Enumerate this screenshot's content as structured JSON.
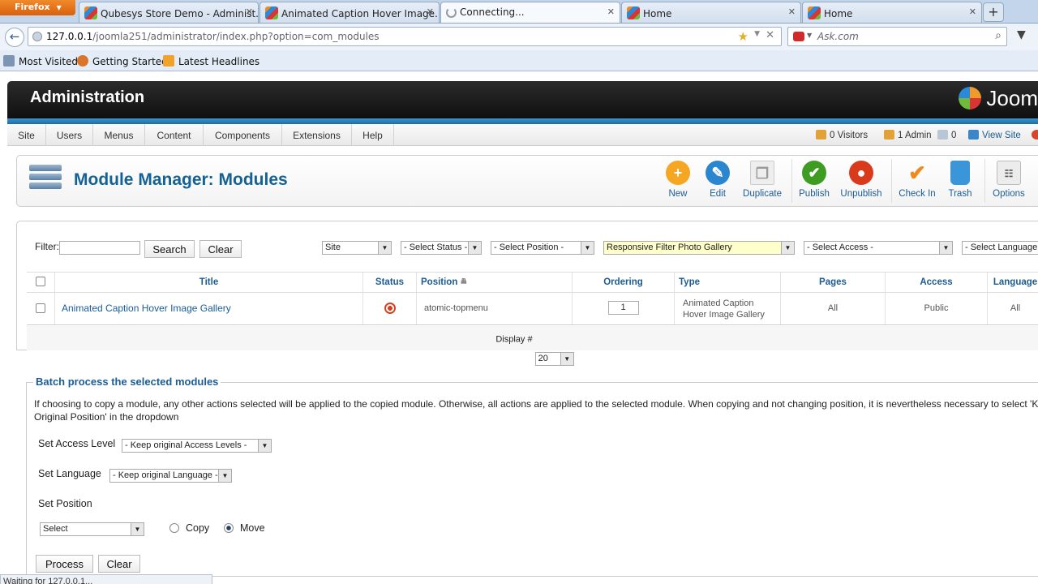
{
  "browser": {
    "menu_label": "Firefox",
    "tabs": [
      {
        "title": "Qubesys Store Demo - Administ..."
      },
      {
        "title": "Animated Caption Hover Image..."
      },
      {
        "title": "Connecting..."
      },
      {
        "title": "Home"
      },
      {
        "title": "Home"
      }
    ],
    "url_host": "127.0.0.1",
    "url_rest": "/joomla251/administrator/index.php?option=com_modules",
    "search_placeholder": "Ask.com",
    "bookmarks": [
      "Most Visited",
      "Getting Started",
      "Latest Headlines"
    ],
    "status_text": "Waiting for 127.0.0.1..."
  },
  "header": {
    "title": "Administration",
    "logo_text": "Joom"
  },
  "menu": {
    "items": [
      "Site",
      "Users",
      "Menus",
      "Content",
      "Components",
      "Extensions",
      "Help"
    ],
    "visitors": "0 Visitors",
    "admins": "1 Admin",
    "messages": "0",
    "view_site": "View Site"
  },
  "toolbar": {
    "page_title": "Module Manager: Modules",
    "buttons": {
      "new": "New",
      "edit": "Edit",
      "duplicate": "Duplicate",
      "publish": "Publish",
      "unpublish": "Unpublish",
      "checkin": "Check In",
      "trash": "Trash",
      "options": "Options"
    },
    "colors": {
      "new": "#f5a623",
      "edit": "#2a86cf",
      "publish": "#3f9c22",
      "unpublish": "#d93a1c",
      "checkin": "#f08a1c",
      "trash": "#3a96d8"
    }
  },
  "filter": {
    "label": "Filter:",
    "value": "",
    "search_label": "Search",
    "clear_label": "Clear",
    "selects": {
      "client": "Site",
      "status": "- Select Status -",
      "position": "- Select Position -",
      "module": "Responsive Filter Photo Gallery",
      "access": "- Select Access -",
      "language": "- Select Language -"
    }
  },
  "table": {
    "columns": {
      "title": "Title",
      "status": "Status",
      "position": "Position",
      "ordering": "Ordering",
      "type": "Type",
      "pages": "Pages",
      "access": "Access",
      "language": "Language"
    },
    "rows": [
      {
        "title": "Animated Caption Hover Image Gallery",
        "status": "unpublished",
        "position": "atomic-topmenu",
        "ordering": "1",
        "type_line1": "Animated Caption",
        "type_line2": "Hover Image Gallery",
        "pages": "All",
        "access": "Public",
        "language": "All"
      }
    ],
    "display_label": "Display #",
    "display_value": "20"
  },
  "batch": {
    "legend": "Batch process the selected modules",
    "tip": "If choosing to copy a module, any other actions selected will be applied to the copied module. Otherwise, all actions are applied to the selected module. When copying and not changing position, it is nevertheless necessary to select 'Keep Original Position' in the dropdown",
    "access_label": "Set Access Level",
    "access_value": "- Keep original Access Levels -",
    "language_label": "Set Language",
    "language_value": "- Keep original Language -",
    "position_label": "Set Position",
    "position_value": "Select",
    "copy_label": "Copy",
    "move_label": "Move",
    "selected_mode": "Move",
    "process_label": "Process",
    "clear_label": "Clear"
  }
}
